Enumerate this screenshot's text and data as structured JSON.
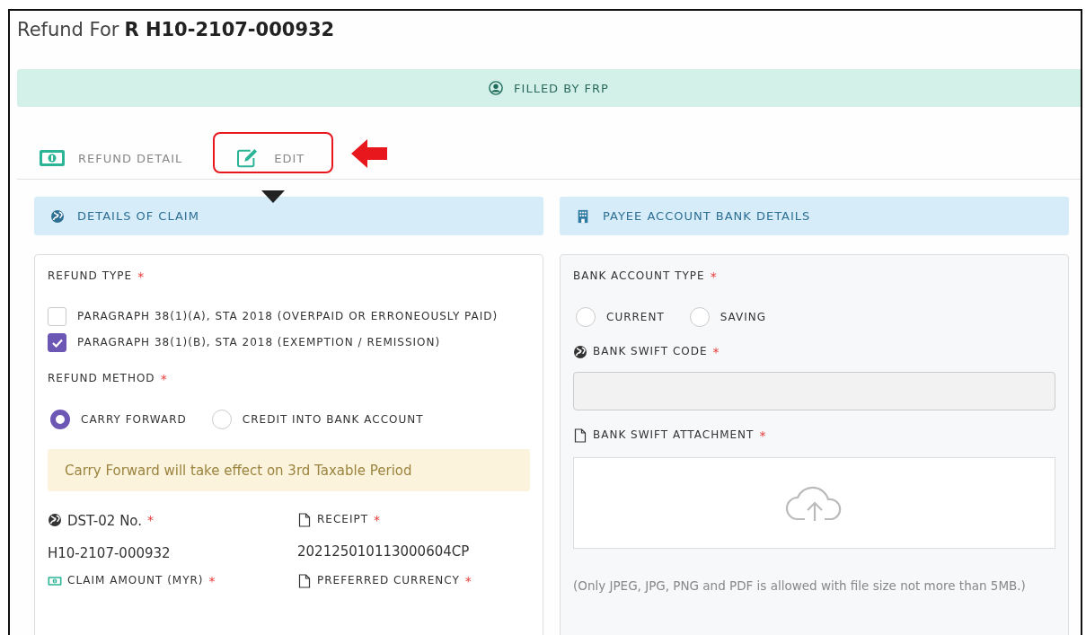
{
  "title": {
    "prefix": "Refund For",
    "id": "R H10-2107-000932"
  },
  "banner": {
    "text": "FILLED BY FRP"
  },
  "tabs": [
    {
      "label": "REFUND DETAIL",
      "selected": false,
      "highlighted": false
    },
    {
      "label": "EDIT",
      "selected": true,
      "highlighted": true
    }
  ],
  "claim": {
    "header": "DETAILS OF CLAIM",
    "refund_type": {
      "label": "REFUND TYPE",
      "mark": "*",
      "options": [
        {
          "label": "PARAGRAPH 38(1)(A), STA 2018 (OVERPAID OR ERRONEOUSLY PAID)",
          "checked": false
        },
        {
          "label": "PARAGRAPH 38(1)(B), STA 2018 (EXEMPTION / REMISSION)",
          "checked": true
        }
      ]
    },
    "refund_method": {
      "label": "REFUND METHOD",
      "mark": "*",
      "options": [
        {
          "label": "CARRY FORWARD",
          "selected": true
        },
        {
          "label": "CREDIT INTO BANK ACCOUNT",
          "selected": false
        }
      ]
    },
    "notice": "Carry Forward will take effect on 3rd Taxable Period",
    "fields": [
      {
        "kind": "large",
        "label": "DST-02 No.",
        "mark": "*",
        "value": "H10-2107-000932"
      },
      {
        "kind": "small",
        "label": "RECEIPT",
        "mark": "*",
        "value": "202125010113000604CP"
      },
      {
        "kind": "small",
        "label": "CLAIM AMOUNT (MYR)",
        "mark": "*"
      },
      {
        "kind": "small",
        "label": "PREFERRED CURRENCY",
        "mark": "*"
      }
    ]
  },
  "bank": {
    "header": "PAYEE ACCOUNT BANK DETAILS",
    "account_type": {
      "label": "BANK ACCOUNT TYPE",
      "mark": "*",
      "options": [
        {
          "label": "CURRENT",
          "selected": false
        },
        {
          "label": "SAVING",
          "selected": false
        }
      ]
    },
    "swift_code": {
      "label": "BANK SWIFT CODE",
      "mark": "*",
      "disabled": true
    },
    "attachment": {
      "label": "BANK SWIFT ATTACHMENT",
      "mark": "*",
      "note": "(Only JPEG, JPG, PNG and PDF is allowed with file size not more than 5MB.)"
    }
  }
}
